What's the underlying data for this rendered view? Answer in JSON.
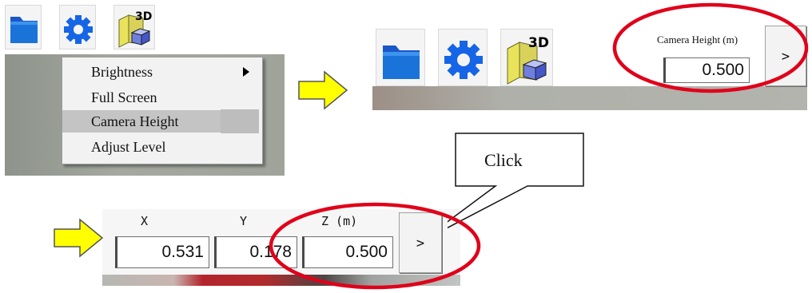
{
  "menu": {
    "items": [
      {
        "label": "Brightness",
        "submenu": true
      },
      {
        "label": "Full Screen",
        "submenu": false
      },
      {
        "label": "Camera Height",
        "submenu": false,
        "highlighted": true
      },
      {
        "label": "Adjust Level",
        "submenu": false
      }
    ]
  },
  "camera_height": {
    "label": "Camera Height (m)",
    "value": "0.500",
    "go_label": ">"
  },
  "coords": {
    "x_label": "X",
    "y_label": "Y",
    "z_label": "Z (m)",
    "x_value": "0.531",
    "y_value": "0.178",
    "z_value": "0.500",
    "go_label": ">"
  },
  "callout": {
    "text": "Click"
  },
  "toolbar": {
    "icons": [
      "folder-icon",
      "gear-icon",
      "3d-view-icon"
    ],
    "badge_3d": "3D"
  },
  "colors": {
    "highlight_ellipse": "#e0001a",
    "arrow_fill": "#ffff00",
    "folder_blue": "#1a73d9",
    "gear_blue": "#1565e6"
  }
}
